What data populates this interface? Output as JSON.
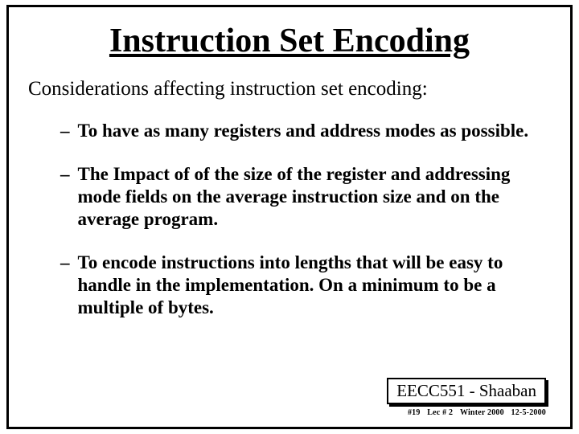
{
  "title": "Instruction Set Encoding",
  "subtitle": "Considerations affecting instruction set encoding:",
  "bullets": [
    "To have as many registers and address modes as possible.",
    "The Impact of of the size of the register and addressing mode fields on the average instruction size and on the average program.",
    "To encode instructions into lengths that will be easy to handle in the implementation.  On a minimum to be a multiple of bytes."
  ],
  "footer": {
    "course": "EECC551 - Shaaban",
    "slide_num": "#19",
    "lecture": "Lec # 2",
    "term": "Winter 2000",
    "date": "12-5-2000"
  }
}
